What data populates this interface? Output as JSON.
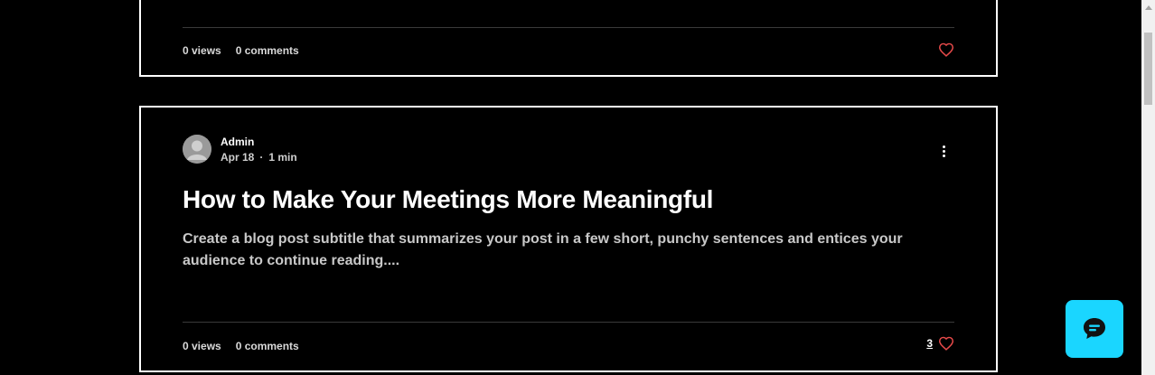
{
  "posts": [
    {
      "views": "0 views",
      "comments": "0 comments"
    },
    {
      "author": "Admin",
      "date": "Apr 18",
      "separator": "·",
      "read_time": "1 min",
      "title": "How to Make Your Meetings More Meaningful",
      "excerpt": "Create a blog post subtitle that summarizes your post in a few short, punchy sentences and entices your audience to continue reading....",
      "views": "0 views",
      "comments": "0 comments",
      "likes": "3"
    }
  ],
  "colors": {
    "background": "#000000",
    "card_border": "#ffffff",
    "heart": "#e84a4a",
    "chat_button": "#1ad6ff",
    "chat_icon": "#111111"
  },
  "icons": {
    "heart": "heart-icon",
    "more": "more-vertical-icon",
    "chat": "chat-bubble-icon",
    "avatar": "user-avatar-icon"
  }
}
